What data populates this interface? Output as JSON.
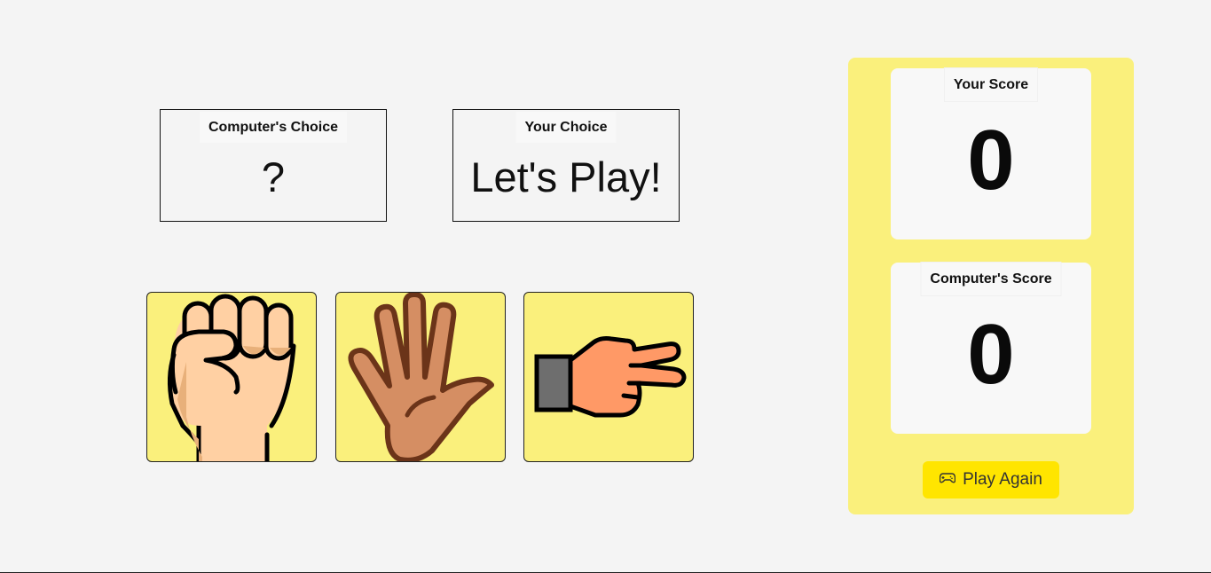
{
  "computer_choice": {
    "label": "Computer's Choice",
    "value": "?"
  },
  "your_choice": {
    "label": "Your Choice",
    "value": "Let's Play!"
  },
  "options": [
    {
      "name": "rock",
      "icon": "fist-icon"
    },
    {
      "name": "paper",
      "icon": "open-hand-icon"
    },
    {
      "name": "scissors",
      "icon": "two-fingers-icon"
    }
  ],
  "scores": {
    "your_label": "Your Score",
    "your_value": "0",
    "computer_label": "Computer's Score",
    "computer_value": "0"
  },
  "play_again": {
    "label": "Play Again",
    "icon": "gamepad-icon"
  },
  "colors": {
    "panel": "#faf07c",
    "button": "#ffe500",
    "background": "#f4f4f4"
  }
}
